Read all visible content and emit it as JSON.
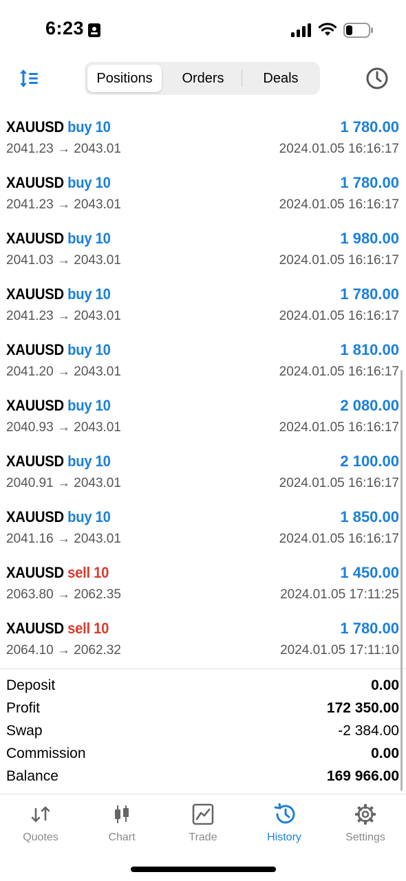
{
  "status_bar": {
    "time": "6:23"
  },
  "header": {
    "segments": [
      "Positions",
      "Orders",
      "Deals"
    ],
    "active_segment": "Positions"
  },
  "deals": [
    {
      "symbol": "XAUUSD",
      "side": "buy 10",
      "type": "buy",
      "open": "2041.23",
      "close": "2043.01",
      "profit": "1 780.00",
      "time": "2024.01.05 16:16:17"
    },
    {
      "symbol": "XAUUSD",
      "side": "buy 10",
      "type": "buy",
      "open": "2041.23",
      "close": "2043.01",
      "profit": "1 780.00",
      "time": "2024.01.05 16:16:17"
    },
    {
      "symbol": "XAUUSD",
      "side": "buy 10",
      "type": "buy",
      "open": "2041.03",
      "close": "2043.01",
      "profit": "1 980.00",
      "time": "2024.01.05 16:16:17"
    },
    {
      "symbol": "XAUUSD",
      "side": "buy 10",
      "type": "buy",
      "open": "2041.23",
      "close": "2043.01",
      "profit": "1 780.00",
      "time": "2024.01.05 16:16:17"
    },
    {
      "symbol": "XAUUSD",
      "side": "buy 10",
      "type": "buy",
      "open": "2041.20",
      "close": "2043.01",
      "profit": "1 810.00",
      "time": "2024.01.05 16:16:17"
    },
    {
      "symbol": "XAUUSD",
      "side": "buy 10",
      "type": "buy",
      "open": "2040.93",
      "close": "2043.01",
      "profit": "2 080.00",
      "time": "2024.01.05 16:16:17"
    },
    {
      "symbol": "XAUUSD",
      "side": "buy 10",
      "type": "buy",
      "open": "2040.91",
      "close": "2043.01",
      "profit": "2 100.00",
      "time": "2024.01.05 16:16:17"
    },
    {
      "symbol": "XAUUSD",
      "side": "buy 10",
      "type": "buy",
      "open": "2041.16",
      "close": "2043.01",
      "profit": "1 850.00",
      "time": "2024.01.05 16:16:17"
    },
    {
      "symbol": "XAUUSD",
      "side": "sell 10",
      "type": "sell",
      "open": "2063.80",
      "close": "2062.35",
      "profit": "1 450.00",
      "time": "2024.01.05 17:11:25"
    },
    {
      "symbol": "XAUUSD",
      "side": "sell 10",
      "type": "sell",
      "open": "2064.10",
      "close": "2062.32",
      "profit": "1 780.00",
      "time": "2024.01.05 17:11:10"
    }
  ],
  "arrow": "→",
  "summary": [
    {
      "label": "Deposit",
      "value": "0.00"
    },
    {
      "label": "Profit",
      "value": "172 350.00"
    },
    {
      "label": "Swap",
      "value": "-2 384.00"
    },
    {
      "label": "Commission",
      "value": "0.00"
    },
    {
      "label": "Balance",
      "value": "169 966.00"
    }
  ],
  "tabs": [
    {
      "label": "Quotes",
      "icon": "quotes-icon"
    },
    {
      "label": "Chart",
      "icon": "chart-icon"
    },
    {
      "label": "Trade",
      "icon": "trade-icon"
    },
    {
      "label": "History",
      "icon": "history-icon"
    },
    {
      "label": "Settings",
      "icon": "gear-icon"
    }
  ],
  "active_tab": "History",
  "colors": {
    "accent": "#1a7fdc",
    "sell": "#dc3a2c",
    "muted": "#555555"
  }
}
